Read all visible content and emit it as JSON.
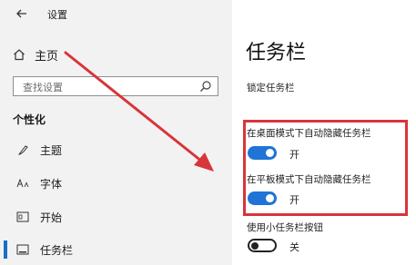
{
  "window": {
    "title": "设置"
  },
  "sidebar": {
    "home_label": "主页",
    "search_placeholder": "查找设置",
    "section_title": "个性化",
    "items": [
      {
        "label": "主题",
        "icon": "theme-icon"
      },
      {
        "label": "字体",
        "icon": "font-icon"
      },
      {
        "label": "开始",
        "icon": "start-icon"
      },
      {
        "label": "任务栏",
        "icon": "taskbar-icon",
        "active": true
      }
    ]
  },
  "main": {
    "title": "任务栏",
    "settings": [
      {
        "label": "锁定任务栏",
        "state": "",
        "on": true
      },
      {
        "label": "在桌面模式下自动隐藏任务栏",
        "state": "开",
        "on": true
      },
      {
        "label": "在平板模式下自动隐藏任务栏",
        "state": "开",
        "on": true
      },
      {
        "label": "使用小任务栏按钮",
        "state": "关",
        "on": false
      }
    ]
  },
  "colors": {
    "accent": "#1f74d6",
    "annotation": "#d8353a"
  }
}
